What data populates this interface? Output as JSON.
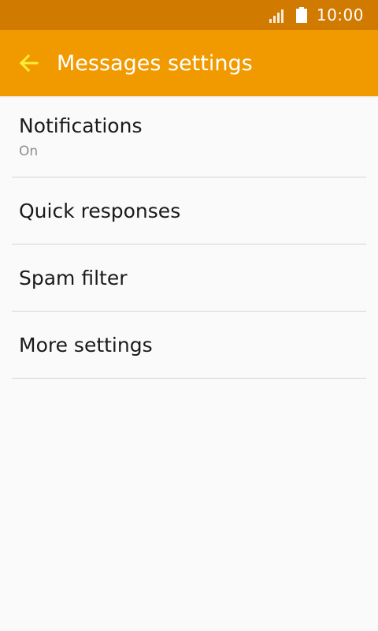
{
  "status_bar": {
    "time": "10:00"
  },
  "app_bar": {
    "title": "Messages settings"
  },
  "settings": [
    {
      "title": "Notifications",
      "subtitle": "On"
    },
    {
      "title": "Quick responses"
    },
    {
      "title": "Spam filter"
    },
    {
      "title": "More settings"
    }
  ],
  "colors": {
    "status_bar": "#d17a00",
    "app_bar": "#f09a00",
    "back_arrow": "#ffeb3b",
    "background": "#fafafa",
    "divider": "#d6d6d6"
  },
  "icons": [
    "signal-icon",
    "battery-icon",
    "back-arrow-icon"
  ]
}
